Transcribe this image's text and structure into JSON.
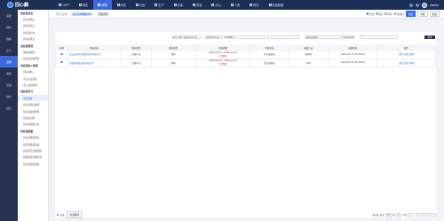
{
  "app": {
    "logo_text": "回心麟",
    "user": "admin"
  },
  "nav": [
    "CAPP",
    "销售",
    "采购",
    "研发",
    "计划",
    "生产",
    "仓库",
    "质量",
    "办公",
    "人资",
    "财务",
    "制造数据"
  ],
  "rail": [
    "系统",
    "销售",
    "物料",
    "生产",
    "采购",
    "质检",
    "仓储",
    "财务",
    "报表"
  ],
  "submenu": [
    {
      "type": "group",
      "label": "供应商信息"
    },
    {
      "type": "item",
      "label": "供应商评估"
    },
    {
      "type": "item",
      "label": "供应商信息"
    },
    {
      "type": "item",
      "label": "供应商分类"
    },
    {
      "type": "item",
      "label": "供应商评分"
    },
    {
      "type": "group",
      "label": "供应商管理"
    },
    {
      "type": "item",
      "label": "采购单处理"
    },
    {
      "type": "item",
      "label": "供应商价格管理"
    },
    {
      "type": "group",
      "label": "供应商准入管理"
    },
    {
      "type": "item",
      "label": "供应商准入"
    },
    {
      "type": "item",
      "label": "今日认证流程"
    },
    {
      "type": "item",
      "label": "准入评估检测"
    },
    {
      "type": "group",
      "label": "供应商评分",
      "active": true
    },
    {
      "type": "item",
      "label": "评估流程"
    },
    {
      "type": "item",
      "label": "供应商评估处理"
    },
    {
      "type": "item",
      "label": "供应商绩效管理"
    },
    {
      "type": "item",
      "label": "供应商分级"
    },
    {
      "type": "item",
      "label": "供应商评级记录"
    },
    {
      "type": "group",
      "label": "供应商质量"
    },
    {
      "type": "item",
      "label": "供应商质量评估"
    },
    {
      "type": "item",
      "label": "供应商质量改进"
    },
    {
      "type": "item",
      "label": "供应商不合格处理"
    },
    {
      "type": "item",
      "label": "质量异常处理表单"
    },
    {
      "type": "item",
      "label": "供应商质量档案"
    }
  ],
  "tabs": {
    "home": "首页(左侧)",
    "current": "供应商周期检查单",
    "select": "筛选条件"
  },
  "tab_radios": [
    "全部",
    "通过",
    "待审",
    "未通过"
  ],
  "tab_buttons": [
    "新增",
    "审批",
    "批量"
  ],
  "filters": {
    "date_label": "评估日期",
    "date_from": "2024-05-15",
    "date_to": "2025-05-14",
    "period_label": "考核周期",
    "status_label": "",
    "supplier_label": "供应商名称",
    "supplier_placeholder": "供应商名称",
    "search": "搜索"
  },
  "table": {
    "headers": [
      "选择",
      "供应商名",
      "供应类型",
      "供应类型",
      "考核周期",
      "考核状态",
      "创建人员",
      "创建时间",
      "操作"
    ],
    "rows": [
      {
        "name": "武汉云科商业智能技术有限公司",
        "type1": "定期产品",
        "type2": "材料",
        "period": "2024-05-15—2024-12-31",
        "period_note": "(已到期)",
        "status": "已完成审批",
        "creator": "张明明",
        "time": "2024-05-15 10:29:40",
        "ops": [
          "详情",
          "修改",
          "删除"
        ]
      },
      {
        "name": "天锐星科技发展有限公司",
        "type1": "定期产品",
        "type2": "材料",
        "period": "2024-05-15—2024-12-31",
        "period_note": "(已到期)",
        "status": "已完成审批",
        "creator": "李明",
        "time": "2024-05-15 10:29:40",
        "ops": [
          "详情",
          "修改",
          "删除"
        ]
      }
    ]
  },
  "footer": {
    "select_all": "全选",
    "batch_delete": "批量删除",
    "total": "共2条",
    "per_page": "每页",
    "per_page_value": "10",
    "per_page_suffix": "条",
    "page_of": "/ 1页"
  }
}
